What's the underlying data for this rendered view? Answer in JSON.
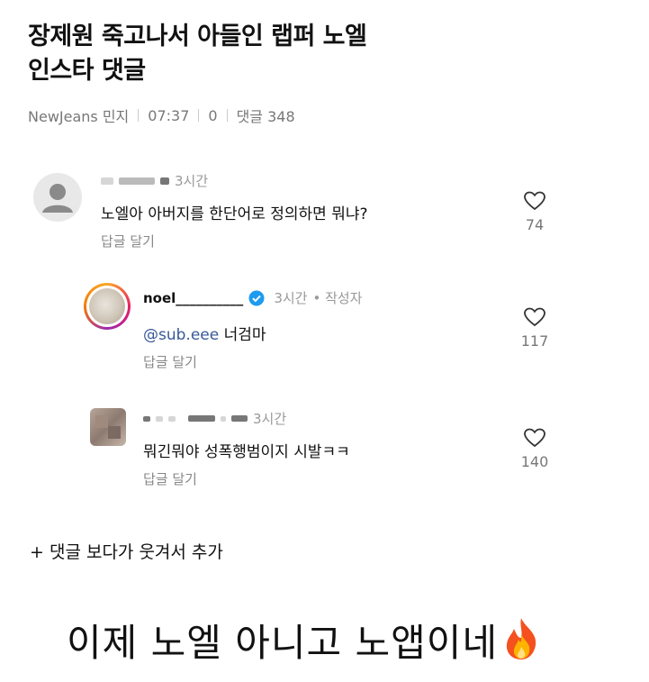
{
  "article": {
    "title_line1": "장제원 죽고나서 아들인 랩퍼 노엘",
    "title_line2": "인스타 댓글",
    "author": "NewJeans 민지",
    "time": "07:37",
    "views": "0",
    "comments_label": "댓글 348"
  },
  "comments": [
    {
      "time": "3시간",
      "text": "노엘아 아버지를 한단어로 정의하면 뭐냐?",
      "reply_label": "답글 달기",
      "likes": "74"
    },
    {
      "username": "noel__________",
      "time": "3시간",
      "author_tag": "• 작성자",
      "mention": "@sub.eee",
      "text": "너검마",
      "reply_label": "답글 달기",
      "likes": "117"
    },
    {
      "time": "3시간",
      "text": "뭐긴뭐야 성폭행범이지 시발ㅋㅋ",
      "reply_label": "답글 달기",
      "likes": "140"
    }
  ],
  "addendum": "+ 댓글 보다가 웃겨서 추가",
  "caption": "이제 노엘 아니고 노앱이네",
  "caption_emoji": "🔥",
  "colors": {
    "verified": "#1d9bf0",
    "mention": "#385898",
    "meta": "#777777"
  }
}
